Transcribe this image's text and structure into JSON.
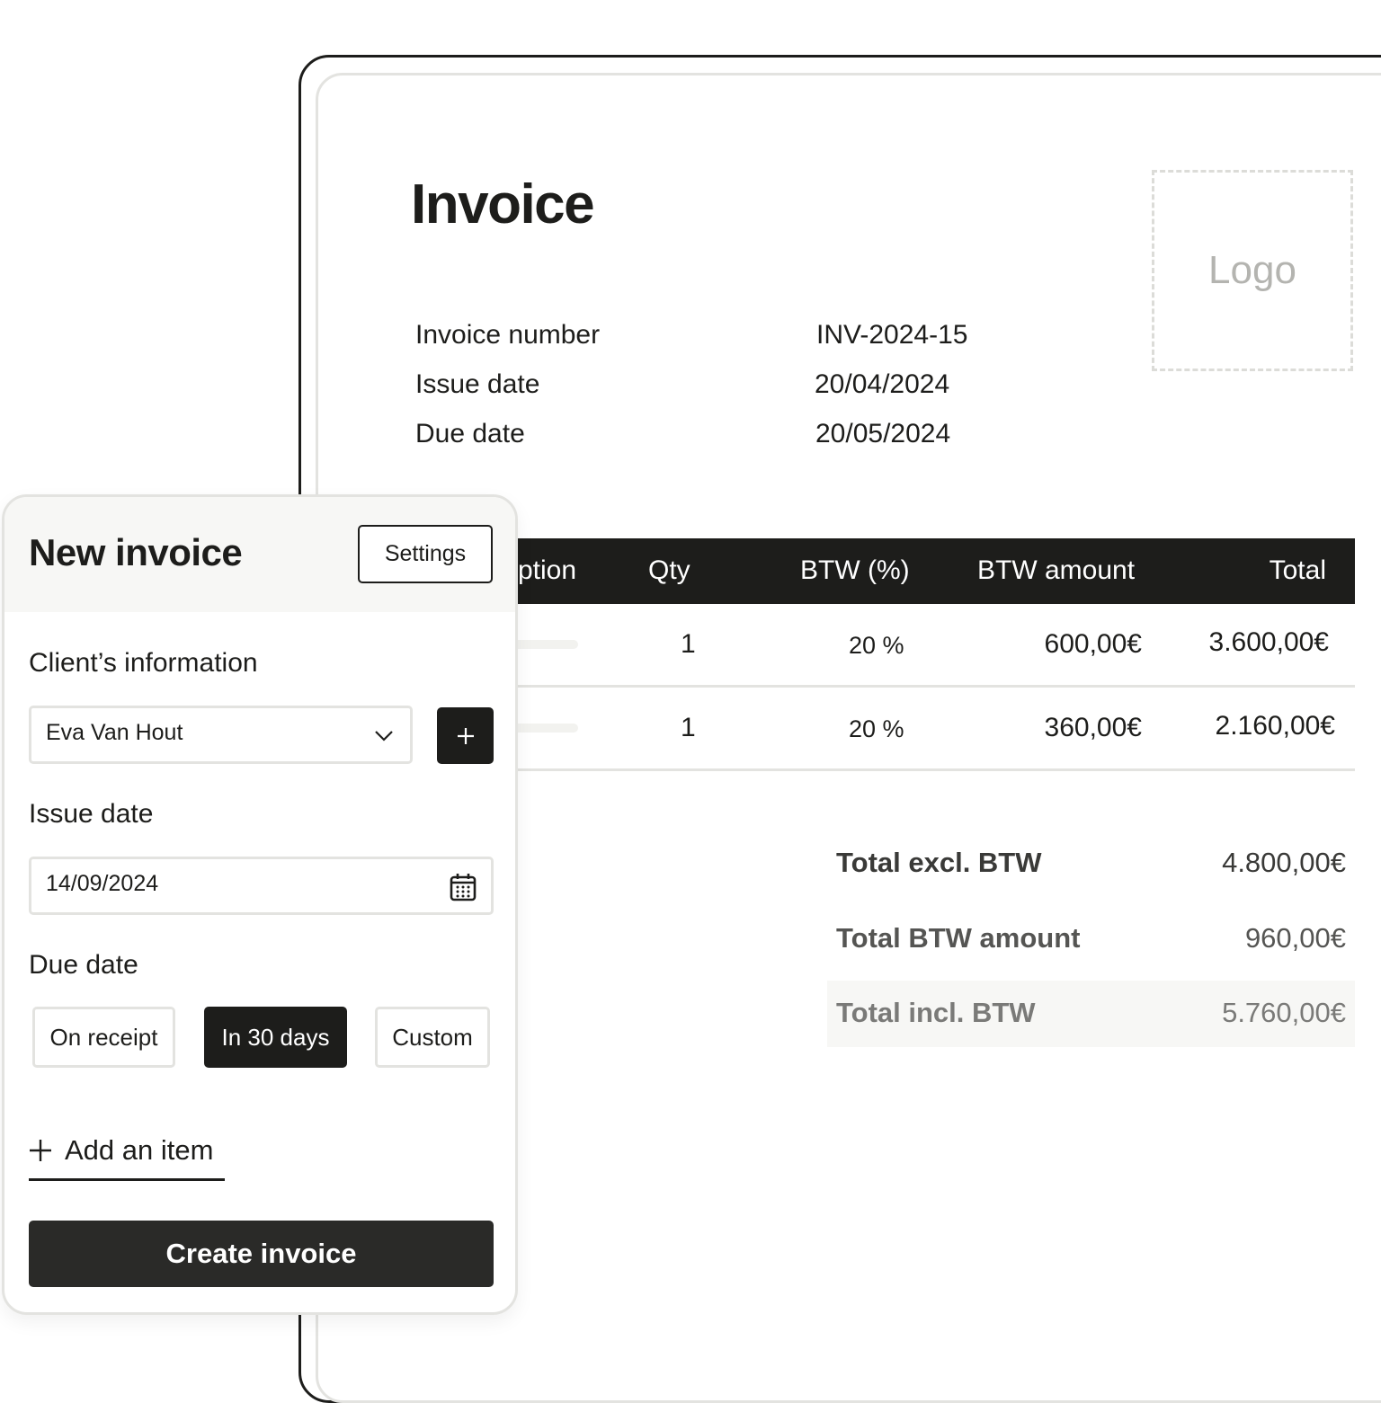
{
  "invoice_preview": {
    "title": "Invoice",
    "logo_placeholder": "Logo",
    "meta": [
      {
        "label": "Invoice number",
        "value": "INV-2024-15"
      },
      {
        "label": "Issue date",
        "value": "20/04/2024"
      },
      {
        "label": "Due date",
        "value": "20/05/2024"
      }
    ],
    "table": {
      "columns": [
        "ption",
        "Qty",
        "BTW (%)",
        "BTW amount",
        "Total"
      ],
      "rows": [
        {
          "description": "",
          "qty": "1",
          "btw_percent": "20 %",
          "btw_amount": "600,00€",
          "total": "3.600,00€"
        },
        {
          "description": "",
          "qty": "1",
          "btw_percent": "20 %",
          "btw_amount": "360,00€",
          "total": "2.160,00€"
        }
      ]
    },
    "totals": [
      {
        "label": "Total excl. BTW",
        "value": "4.800,00€"
      },
      {
        "label": "Total BTW amount",
        "value": "960,00€"
      },
      {
        "label": "Total incl. BTW",
        "value": "5.760,00€"
      }
    ]
  },
  "panel": {
    "title": "New invoice",
    "settings_label": "Settings",
    "client_section_label": "Client’s information",
    "client_selected": "Eva Van Hout",
    "issue_date_label": "Issue date",
    "issue_date_value": "14/09/2024",
    "due_date_label": "Due date",
    "due_options": [
      {
        "label": "On receipt",
        "selected": false
      },
      {
        "label": "In 30 days",
        "selected": true
      },
      {
        "label": "Custom",
        "selected": false
      }
    ],
    "add_item_label": "Add an item",
    "create_label": "Create invoice"
  },
  "colors": {
    "primary_dark": "#1d1d1b",
    "border_light": "#e3e3e0",
    "panel_header_bg": "#f7f7f5",
    "muted_text": "#b4b4b0"
  }
}
